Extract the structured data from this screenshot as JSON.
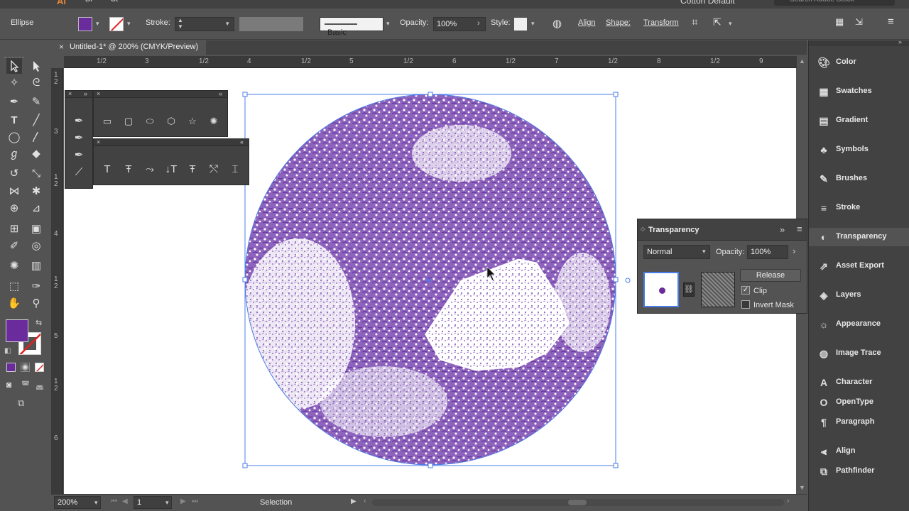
{
  "app": {
    "logo": "Ai",
    "br": "Br",
    "st": "St",
    "workspace": "Cotton Default",
    "search_placeholder": "Search Adobe Stock"
  },
  "control_bar": {
    "object_type": "Ellipse",
    "fill_color": "#6a2c9c",
    "stroke_label": "Stroke:",
    "brush_label": "Basic",
    "opacity_label": "Opacity:",
    "opacity_value": "100%",
    "style_label": "Style:",
    "align_label": "Align",
    "shape_label": "Shape:",
    "transform_label": "Transform"
  },
  "document": {
    "tab_title": "Untitled-1* @ 200% (CMYK/Preview)"
  },
  "ruler": {
    "horizontal": [
      "1/2",
      "3",
      "1/2",
      "4",
      "1/2",
      "5",
      "1/2",
      "6",
      "1/2",
      "7",
      "1/2",
      "8",
      "1/2",
      "9"
    ],
    "vertical": [
      "1",
      "2",
      "3",
      "1",
      "2",
      "4",
      "1",
      "2",
      "5",
      "1",
      "2",
      "6"
    ]
  },
  "status_bar": {
    "zoom": "200%",
    "artboard": "1",
    "tool_status": "Selection"
  },
  "transparency_panel": {
    "title": "Transparency",
    "blend_mode": "Normal",
    "opacity_label": "Opacity:",
    "opacity_value": "100%",
    "release_button": "Release",
    "clip_label": "Clip",
    "clip_checked": true,
    "invert_mask_label": "Invert Mask",
    "invert_mask_checked": false
  },
  "dock": {
    "items": [
      {
        "label": "Color",
        "icon": "color-icon"
      },
      {
        "label": "Swatches",
        "icon": "swatches-icon"
      },
      {
        "label": "Gradient",
        "icon": "gradient-icon"
      },
      {
        "label": "Symbols",
        "icon": "symbols-icon"
      },
      {
        "label": "Brushes",
        "icon": "brushes-icon"
      },
      {
        "label": "Stroke",
        "icon": "stroke-icon"
      },
      {
        "label": "Transparency",
        "icon": "transparency-icon"
      },
      {
        "label": "Asset Export",
        "icon": "asset-export-icon"
      },
      {
        "label": "Layers",
        "icon": "layers-icon"
      },
      {
        "label": "Appearance",
        "icon": "appearance-icon"
      },
      {
        "label": "Image Trace",
        "icon": "image-trace-icon"
      },
      {
        "label": "Character",
        "icon": "character-icon"
      },
      {
        "label": "OpenType",
        "icon": "opentype-icon"
      },
      {
        "label": "Paragraph",
        "icon": "paragraph-icon"
      },
      {
        "label": "Align",
        "icon": "align-icon"
      },
      {
        "label": "Pathfinder",
        "icon": "pathfinder-icon"
      }
    ]
  },
  "colors": {
    "fill": "#6a2c9c",
    "artwork": "#7b4bb0",
    "selection": "#4a7ce8"
  }
}
